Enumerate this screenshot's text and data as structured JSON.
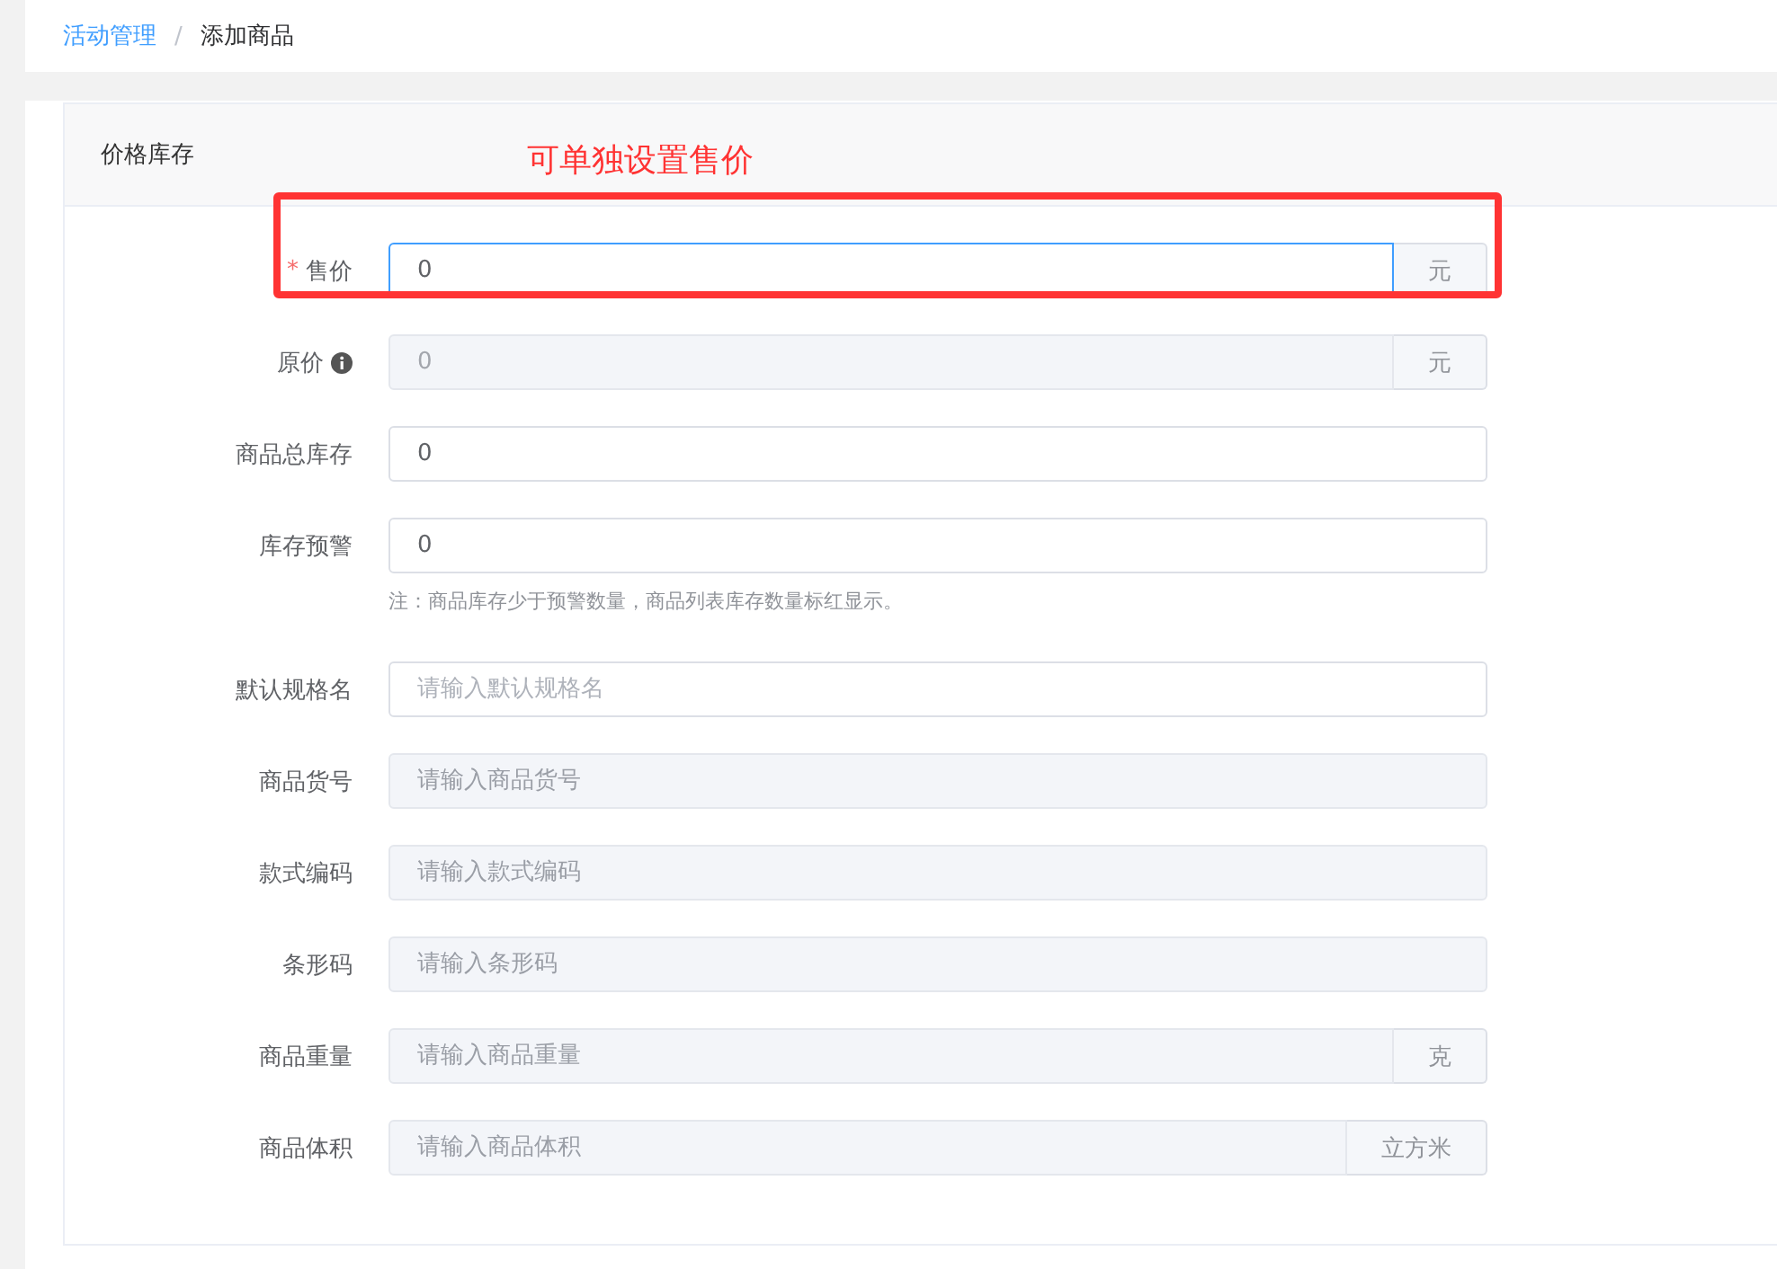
{
  "breadcrumb": [
    {
      "label": "活动管理",
      "link": true
    },
    {
      "label": "添加商品",
      "link": false
    }
  ],
  "breadcrumb_separator": "/",
  "section": {
    "title": "价格库存"
  },
  "required_symbol": "*",
  "annotation": {
    "text": "可单独设置售价"
  },
  "fields": [
    {
      "label": "售价",
      "required": true,
      "info": false,
      "value": "0",
      "disabled": false,
      "focused": true,
      "suffix": "元"
    },
    {
      "label": "原价",
      "required": false,
      "info": true,
      "value": "0",
      "disabled": true,
      "focused": false,
      "suffix": "元"
    },
    {
      "label": "商品总库存",
      "required": false,
      "info": false,
      "value": "0",
      "disabled": false,
      "focused": false
    },
    {
      "label": "库存预警",
      "required": false,
      "info": false,
      "value": "0",
      "disabled": false,
      "focused": false,
      "note": "注：商品库存少于预警数量，商品列表库存数量标红显示。"
    },
    {
      "label": "默认规格名",
      "required": false,
      "info": false,
      "placeholder": "请输入默认规格名",
      "disabled": false,
      "focused": false
    },
    {
      "label": "商品货号",
      "required": false,
      "info": false,
      "placeholder": "请输入商品货号",
      "disabled": true,
      "focused": false
    },
    {
      "label": "款式编码",
      "required": false,
      "info": false,
      "placeholder": "请输入款式编码",
      "disabled": true,
      "focused": false
    },
    {
      "label": "条形码",
      "required": false,
      "info": false,
      "placeholder": "请输入条形码",
      "disabled": true,
      "focused": false
    },
    {
      "label": "商品重量",
      "required": false,
      "info": false,
      "placeholder": "请输入商品重量",
      "disabled": true,
      "focused": false,
      "suffix": "克"
    },
    {
      "label": "商品体积",
      "required": false,
      "info": false,
      "placeholder": "请输入商品体积",
      "disabled": true,
      "focused": false,
      "suffix": "立方米"
    }
  ]
}
